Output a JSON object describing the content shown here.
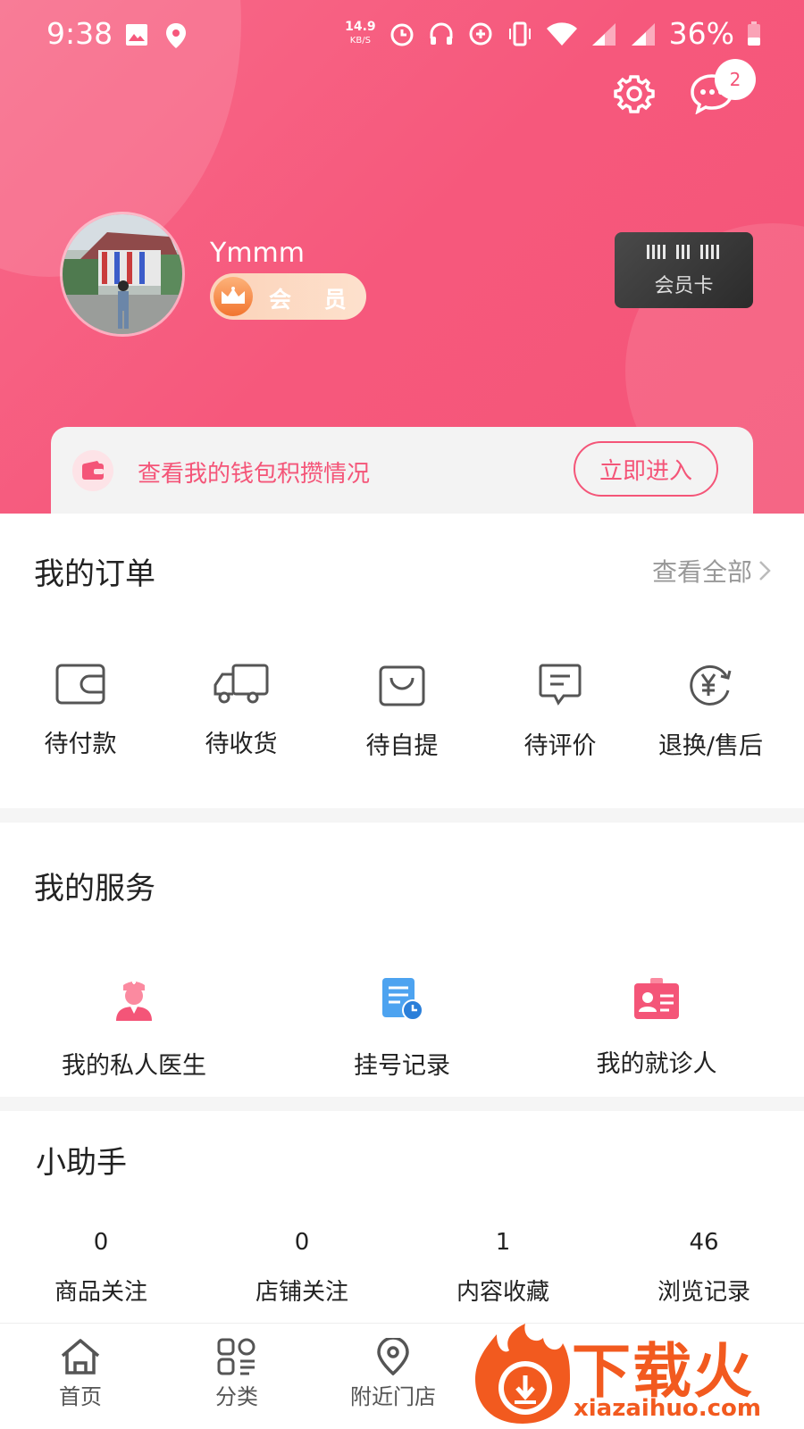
{
  "status_bar": {
    "time": "9:38",
    "net_speed_value": "14.9",
    "net_speed_unit": "KB/S",
    "battery": "36%"
  },
  "header": {
    "message_badge_count": "2",
    "username": "Ymmm",
    "member_label": "会 员",
    "vip_card_label": "会员卡",
    "wallet_text": "查看我的钱包积攒情况",
    "wallet_button": "立即进入",
    "brand_color": "#f45578"
  },
  "orders": {
    "title": "我的订单",
    "view_all": "查看全部",
    "items": [
      {
        "label": "待付款",
        "icon": "wallet-icon"
      },
      {
        "label": "待收货",
        "icon": "truck-icon"
      },
      {
        "label": "待自提",
        "icon": "bag-icon"
      },
      {
        "label": "待评价",
        "icon": "comment-icon"
      },
      {
        "label": "退换/售后",
        "icon": "refund-icon"
      }
    ]
  },
  "services": {
    "title": "我的服务",
    "items": [
      {
        "label": "我的私人医生",
        "icon": "doctor-icon"
      },
      {
        "label": "挂号记录",
        "icon": "registration-record-icon"
      },
      {
        "label": "我的就诊人",
        "icon": "patient-card-icon"
      }
    ]
  },
  "assistant": {
    "title": "小助手",
    "stats": [
      {
        "value": "0",
        "label": "商品关注"
      },
      {
        "value": "0",
        "label": "店铺关注"
      },
      {
        "value": "1",
        "label": "内容收藏"
      },
      {
        "value": "46",
        "label": "浏览记录"
      }
    ]
  },
  "bottom_nav": {
    "items": [
      {
        "label": "首页",
        "icon": "home-icon"
      },
      {
        "label": "分类",
        "icon": "category-icon"
      },
      {
        "label": "附近门店",
        "icon": "location-icon"
      }
    ]
  },
  "watermark": {
    "text": "下载火",
    "url": "xiazaihuo.com"
  }
}
